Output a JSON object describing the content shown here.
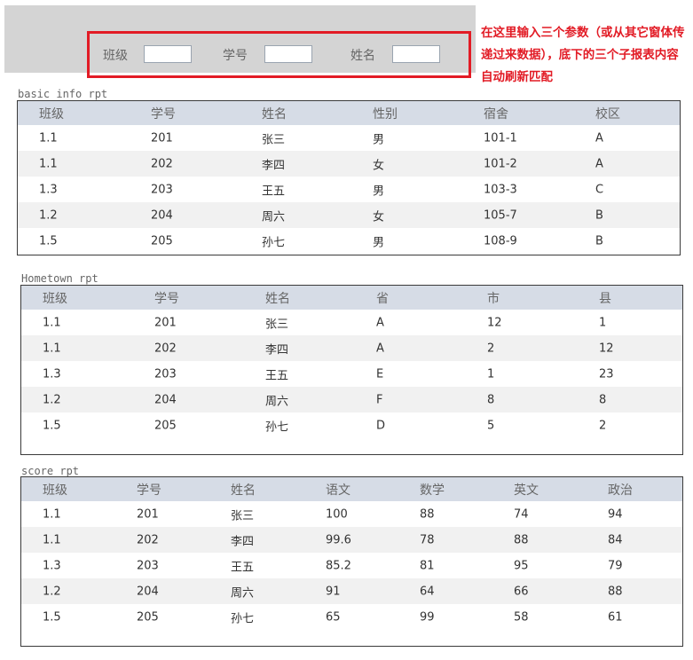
{
  "params": {
    "fields": [
      {
        "label": "班级",
        "value": ""
      },
      {
        "label": "学号",
        "value": ""
      },
      {
        "label": "姓名",
        "value": ""
      }
    ],
    "note": "在这里输入三个参数（或从其它窗体传递过来数据），底下的三个子报表内容自动刷新匹配"
  },
  "reports": [
    {
      "title": "basic info rpt",
      "columns": [
        "班级",
        "学号",
        "姓名",
        "性别",
        "宿舍",
        "校区"
      ],
      "rows": [
        [
          "1.1",
          "201",
          "张三",
          "男",
          "101-1",
          "A"
        ],
        [
          "1.1",
          "202",
          "李四",
          "女",
          "101-2",
          "A"
        ],
        [
          "1.3",
          "203",
          "王五",
          "男",
          "103-3",
          "C"
        ],
        [
          "1.2",
          "204",
          "周六",
          "女",
          "105-7",
          "B"
        ],
        [
          "1.5",
          "205",
          "孙七",
          "男",
          "108-9",
          "B"
        ]
      ]
    },
    {
      "title": "Hometown rpt",
      "columns": [
        "班级",
        "学号",
        "姓名",
        "省",
        "市",
        "县"
      ],
      "rows": [
        [
          "1.1",
          "201",
          "张三",
          "A",
          "12",
          "1"
        ],
        [
          "1.1",
          "202",
          "李四",
          "A",
          "2",
          "12"
        ],
        [
          "1.3",
          "203",
          "王五",
          "E",
          "1",
          "23"
        ],
        [
          "1.2",
          "204",
          "周六",
          "F",
          "8",
          "8"
        ],
        [
          "1.5",
          "205",
          "孙七",
          "D",
          "5",
          "2"
        ]
      ]
    },
    {
      "title": "score rpt",
      "columns": [
        "班级",
        "学号",
        "姓名",
        "语文",
        "数学",
        "英文",
        "政治"
      ],
      "rows": [
        [
          "1.1",
          "201",
          "张三",
          "100",
          "88",
          "74",
          "94"
        ],
        [
          "1.1",
          "202",
          "李四",
          "99.6",
          "78",
          "88",
          "84"
        ],
        [
          "1.3",
          "203",
          "王五",
          "85.2",
          "81",
          "95",
          "79"
        ],
        [
          "1.2",
          "204",
          "周六",
          "91",
          "64",
          "66",
          "88"
        ],
        [
          "1.5",
          "205",
          "孙七",
          "65",
          "99",
          "58",
          "61"
        ]
      ]
    }
  ]
}
